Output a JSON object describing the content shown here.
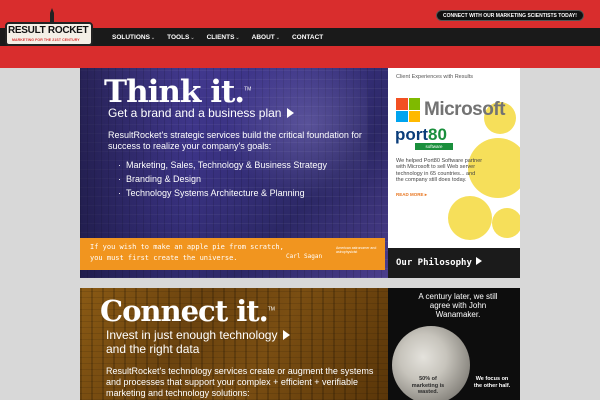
{
  "header": {
    "logo": {
      "wordmark": "RESULT ROCKET",
      "tagline": "MARKETING FOR THE 21ST CENTURY"
    },
    "nav": [
      {
        "label": "SOLUTIONS",
        "has_menu": true
      },
      {
        "label": "TOOLS",
        "has_menu": true
      },
      {
        "label": "CLIENTS",
        "has_menu": true
      },
      {
        "label": "ABOUT",
        "has_menu": true
      },
      {
        "label": "CONTACT",
        "has_menu": false
      }
    ],
    "chevron": "⌄",
    "cta_label": "CONNECT WITH OUR MARKETING SCIENTISTS TODAY!"
  },
  "panel_think": {
    "headline": "Think it.",
    "tm": "TM",
    "subhead": "Get a brand and a business plan",
    "intro": "ResultRocket's strategic services build the critical foundation for success to realize your company's goals:",
    "bullets": [
      "Marketing, Sales, Technology & Business Strategy",
      "Branding & Design",
      "Technology Systems Architecture & Planning"
    ],
    "quote": {
      "text": "If you wish to make an apple pie from scratch, you must first create the universe.",
      "author": "Carl Sagan",
      "note": "American astronomer and astrophysicist"
    },
    "sidebar": {
      "title": "Client Experiences with Results",
      "microsoft": "Microsoft",
      "port80": {
        "name": "port",
        "num": "80",
        "sub": "software"
      },
      "text": "We helped Port80 Software partner with Microsoft to sell Web server technology in 65 countries... and the company still does today.",
      "readmore": "READ MORE ▸"
    },
    "philosophy_label": "Our Philosophy"
  },
  "panel_connect": {
    "headline": "Connect it.",
    "tm": "TM",
    "subhead_line1": "Invest in just enough technology",
    "subhead_line2": "and the right data",
    "intro": "ResultRocket's technology services create or augment the systems and processes that support your complex + efficient + verifiable marketing and technology solutions:",
    "sidebar": {
      "quote": "A century later, we still agree with John Wanamaker.",
      "stat_left": "50% of marketing is wasted.",
      "stat_right": "We focus on the other half."
    }
  },
  "colors": {
    "brand_red": "#d92d2d",
    "orange": "#f1951f",
    "purple": "#3b3385",
    "bronze": "#6b430f"
  }
}
